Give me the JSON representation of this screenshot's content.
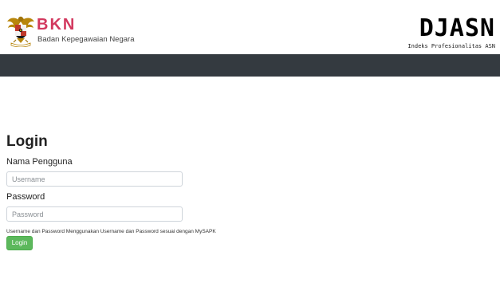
{
  "header": {
    "brand": "BKN",
    "brand_subtitle": "Badan Kepegawaian Negara",
    "logo_icon": "garuda-emblem-icon",
    "app_title": "DJASN",
    "app_subtitle": "Indeks Profesionalitas ASN"
  },
  "colors": {
    "brand": "#d2385e",
    "navbar": "#343a40",
    "login_button": "#5cb85c"
  },
  "login": {
    "title": "Login",
    "username_label": "Nama Pengguna",
    "username_placeholder": "Username",
    "username_value": "",
    "password_label": "Password",
    "password_placeholder": "Password",
    "password_value": "",
    "hint": "Username dan Password Menggunakan Username dan Password sesuai dengan MySAPK",
    "submit_label": "Login"
  }
}
